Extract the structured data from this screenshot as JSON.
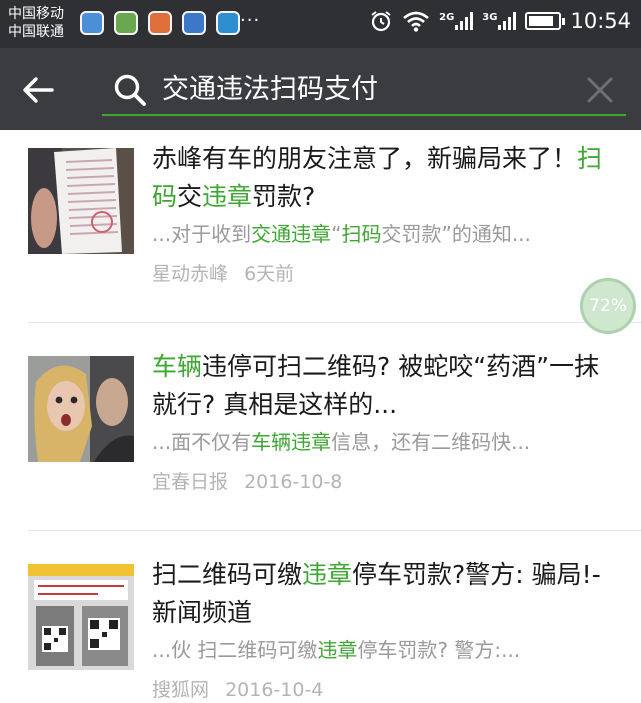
{
  "status_bar": {
    "carrier_1": "中国移动",
    "carrier_2": "中国联通",
    "overflow": "···",
    "net_1": "2G",
    "net_2": "3G",
    "time": "10:54"
  },
  "search": {
    "query": "交通违法扫码支付"
  },
  "results": [
    {
      "title": [
        {
          "t": "赤峰有车的朋友注意了，新骗局来了！",
          "hl": false
        },
        {
          "t": "扫码",
          "hl": true
        },
        {
          "t": "交",
          "hl": false
        },
        {
          "t": "违章",
          "hl": true
        },
        {
          "t": "罚款?",
          "hl": false
        }
      ],
      "snippet": [
        {
          "t": "...对于收到",
          "hl": false
        },
        {
          "t": "交通违章",
          "hl": true
        },
        {
          "t": "“",
          "hl": false
        },
        {
          "t": "扫码",
          "hl": true
        },
        {
          "t": "交罚款”的通知...",
          "hl": false
        }
      ],
      "source": "星动赤峰",
      "date": "6天前"
    },
    {
      "title": [
        {
          "t": "车辆",
          "hl": true
        },
        {
          "t": "违停可扫二维码? 被蛇咬“药酒”一抹就行? 真相是这样的...",
          "hl": false
        }
      ],
      "snippet": [
        {
          "t": "...面不仅有",
          "hl": false
        },
        {
          "t": "车辆违章",
          "hl": true
        },
        {
          "t": "信息，还有二维码快...",
          "hl": false
        }
      ],
      "source": "宜春日报",
      "date": "2016-10-8"
    },
    {
      "title": [
        {
          "t": "扫二维码可缴",
          "hl": false
        },
        {
          "t": "违章",
          "hl": true
        },
        {
          "t": "停车罚款?警方: 骗局!-新闻频道",
          "hl": false
        }
      ],
      "snippet": [
        {
          "t": "...伙 扫二维码可缴",
          "hl": false
        },
        {
          "t": "违章",
          "hl": true
        },
        {
          "t": "停车罚款? 警方:...",
          "hl": false
        }
      ],
      "source": "搜狐网",
      "date": "2016-10-4"
    }
  ],
  "progress": {
    "label": "72%",
    "value": 0.72
  },
  "colors": {
    "highlight": "#3ea633",
    "header_bg": "#3a3c3f",
    "status_bg": "#2e3033"
  },
  "icons": [
    "back-arrow-icon",
    "search-icon",
    "close-icon",
    "alarm-icon",
    "wifi-icon",
    "battery-icon"
  ]
}
